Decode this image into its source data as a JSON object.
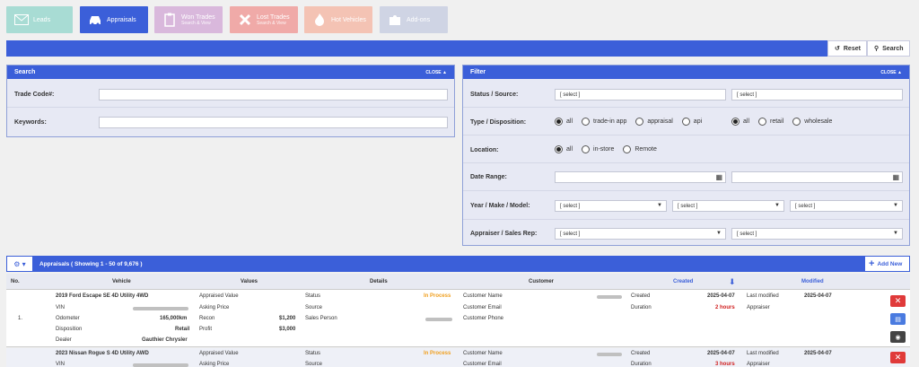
{
  "tabs": [
    {
      "label": "Leads",
      "sub": "",
      "icon": "envelope-icon",
      "bg": "#a8dcd4"
    },
    {
      "label": "Appraisals",
      "sub": "",
      "icon": "car-icon",
      "bg": "#3b5fd9"
    },
    {
      "label": "Won Trades",
      "sub": "Search & View",
      "icon": "clipboard-icon",
      "bg": "#d9b8dc"
    },
    {
      "label": "Lost Trades",
      "sub": "Search & View",
      "icon": "x-icon",
      "bg": "#f0aaa8"
    },
    {
      "label": "Hot Vehicles",
      "sub": "",
      "icon": "flame-icon",
      "bg": "#f4c3b4"
    },
    {
      "label": "Add-ons",
      "sub": "",
      "icon": "puzzle-icon",
      "bg": "#cfd4e4"
    }
  ],
  "toolbar": {
    "reset": "Reset",
    "search": "Search"
  },
  "search_panel": {
    "title": "Search",
    "close": "CLOSE",
    "trade_code_label": "Trade Code#:",
    "keywords_label": "Keywords:"
  },
  "filter_panel": {
    "title": "Filter",
    "close": "CLOSE",
    "status_label": "Status / Source:",
    "select": "[ select ]",
    "type_label": "Type / Disposition:",
    "type_options": [
      "all",
      "trade-in app",
      "appraisal",
      "api"
    ],
    "disp_options": [
      "all",
      "retail",
      "wholesale"
    ],
    "location_label": "Location:",
    "location_options": [
      "all",
      "in-store",
      "Remote"
    ],
    "date_label": "Date Range:",
    "ymm_label": "Year / Make / Model:",
    "appraiser_label": "Appraiser / Sales Rep:"
  },
  "grid": {
    "title": "Appraisals ( Showing 1 - 50 of 9,676 )",
    "add_new": "Add New",
    "columns": {
      "no": "No.",
      "vehicle": "Vehicle",
      "values": "Values",
      "details": "Details",
      "customer": "Customer",
      "created": "Created",
      "modified": "Modified"
    },
    "rows": [
      {
        "no": "1.",
        "vehicle": "2019 Ford Escape SE 4D Utility 4WD",
        "vin_label": "VIN",
        "odometer_label": "Odometer",
        "odometer": "165,000km",
        "disposition_label": "Disposition",
        "disposition": "Retail",
        "dealer_label": "Dealer",
        "dealer": "Gauthier Chrysler",
        "appraised_label": "Appraised Value",
        "asking_label": "Asking Price",
        "recon_label": "Recon",
        "recon": "$1,200",
        "profit_label": "Profit",
        "profit": "$3,000",
        "status_label": "Status",
        "status": "In Process",
        "source_label": "Source",
        "salesperson_label": "Sales Person",
        "cust_name_label": "Customer Name",
        "cust_email_label": "Customer Email",
        "cust_phone_label": "Customer Phone",
        "created_label": "Created",
        "created": "2025-04-07",
        "duration_label": "Duration",
        "duration": "2 hours",
        "modified_label": "Last modified",
        "modified": "2025-04-07",
        "appraiser_label": "Appraiser"
      },
      {
        "no": "",
        "vehicle": "2023 Nissan Rogue S 4D Utility AWD",
        "vin_label": "VIN",
        "appraised_label": "Appraised Value",
        "asking_label": "Asking Price",
        "status_label": "Status",
        "status": "In Process",
        "source_label": "Source",
        "cust_name_label": "Customer Name",
        "cust_email_label": "Customer Email",
        "created_label": "Created",
        "created": "2025-04-07",
        "duration_label": "Duration",
        "duration": "3 hours",
        "modified_label": "Last modified",
        "modified": "2025-04-07",
        "appraiser_label": "Appraiser"
      }
    ]
  },
  "colors": {
    "accent": "#3b5fd9",
    "status": "#f0a020",
    "duration": "#d02020",
    "delete": "#e03a3a",
    "doc": "#4a7be0",
    "view": "#444"
  }
}
